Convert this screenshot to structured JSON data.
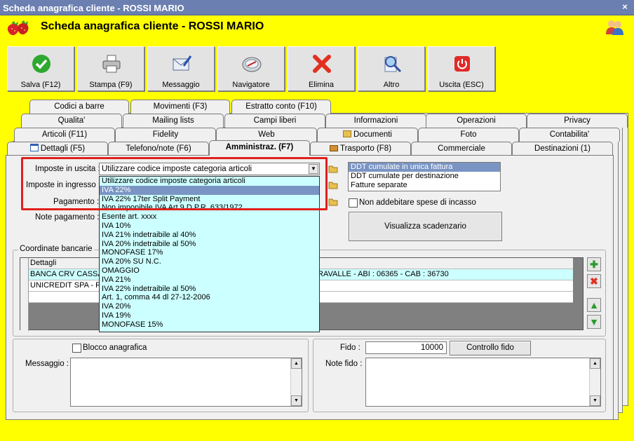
{
  "window": {
    "title": "Scheda anagrafica cliente - ROSSI MARIO",
    "close": "×"
  },
  "header": {
    "title": "Scheda anagrafica cliente - ROSSI MARIO"
  },
  "toolbar": [
    {
      "label": "Salva (F12)",
      "icon": "check-icon"
    },
    {
      "label": "Stampa (F9)",
      "icon": "printer-icon"
    },
    {
      "label": "Messaggio",
      "icon": "mail-icon"
    },
    {
      "label": "Navigatore",
      "icon": "compass-icon"
    },
    {
      "label": "Elimina",
      "icon": "delete-x-icon"
    },
    {
      "label": "Altro",
      "icon": "magnifier-icon"
    },
    {
      "label": "Uscita (ESC)",
      "icon": "power-icon"
    }
  ],
  "tabs": {
    "row1": [
      "Codici a barre",
      "Movimenti (F3)",
      "Estratto conto (F10)"
    ],
    "row2": [
      "Qualita'",
      "Mailing lists",
      "Campi liberi",
      "Informazioni",
      "Operazioni",
      "Privacy"
    ],
    "row3": [
      "Articoli (F11)",
      "Fidelity",
      "Web",
      "Documenti",
      "Foto",
      "Contabilita'"
    ],
    "row4": [
      "Dettagli (F5)",
      "Telefono/note (F6)",
      "Amministraz. (F7)",
      "Trasporto (F8)",
      "Commerciale",
      "Destinazioni (1)"
    ]
  },
  "form": {
    "imposte_uscita_label": "Imposte in uscita :",
    "imposte_uscita_value": "Utilizzare codice imposte categoria articoli",
    "imposte_ingresso_label": "Imposte in ingresso :",
    "pagamento_label": "Pagamento :",
    "note_pagamento_label": "Note pagamento :"
  },
  "dropdown_options": [
    "Utilizzare codice imposte categoria articoli",
    "IVA 22%",
    "IVA 22% 17ter Split Payment",
    "Non imponibile IVA Art.9 D.P.R. 633/1972",
    "Esente art. xxxx",
    "IVA 10%",
    "IVA 21% indetraibile al 40%",
    "IVA 20% indetraibile al 50%",
    "MONOFASE 17%",
    "IVA 20% SU N.C.",
    "OMAGGIO",
    "IVA 21%",
    "IVA 22% indetraibile al 50%",
    "Art. 1, comma 44 dl 27-12-2006",
    "IVA 20%",
    "IVA 19%",
    "MONOFASE 15%"
  ],
  "dropdown_selected_index": 1,
  "ddt_options": [
    "DDT cumulate in unica fattura",
    "DDT cumulate per destinazione",
    "Fatture separate"
  ],
  "ddt_selected_index": 0,
  "non_addebitare_label": "Non addebitare spese di incasso",
  "visualizza_scadenzario": "Visualizza scadenzario",
  "coordinate": {
    "group_label": "Coordinate bancarie",
    "column": "Dettagli",
    "rows": [
      {
        "left": "BANCA CRV CASSA R",
        "right": "RAVALLE - ABI : 06365 - CAB : 36730"
      },
      {
        "left": "UNICREDIT SPA - RI",
        "right": ""
      }
    ]
  },
  "blocco_label": "Blocco anagrafica",
  "messaggio_label": "Messaggio :",
  "fido_label": "Fido :",
  "fido_value": "10000",
  "controllo_fido": "Controllo fido",
  "note_fido_label": "Note fido :",
  "colors": {
    "window_bg": "#ffff00",
    "dropdown_bg": "#ccffff",
    "selection": "#7a95c4",
    "highlight": "#e0201c"
  }
}
